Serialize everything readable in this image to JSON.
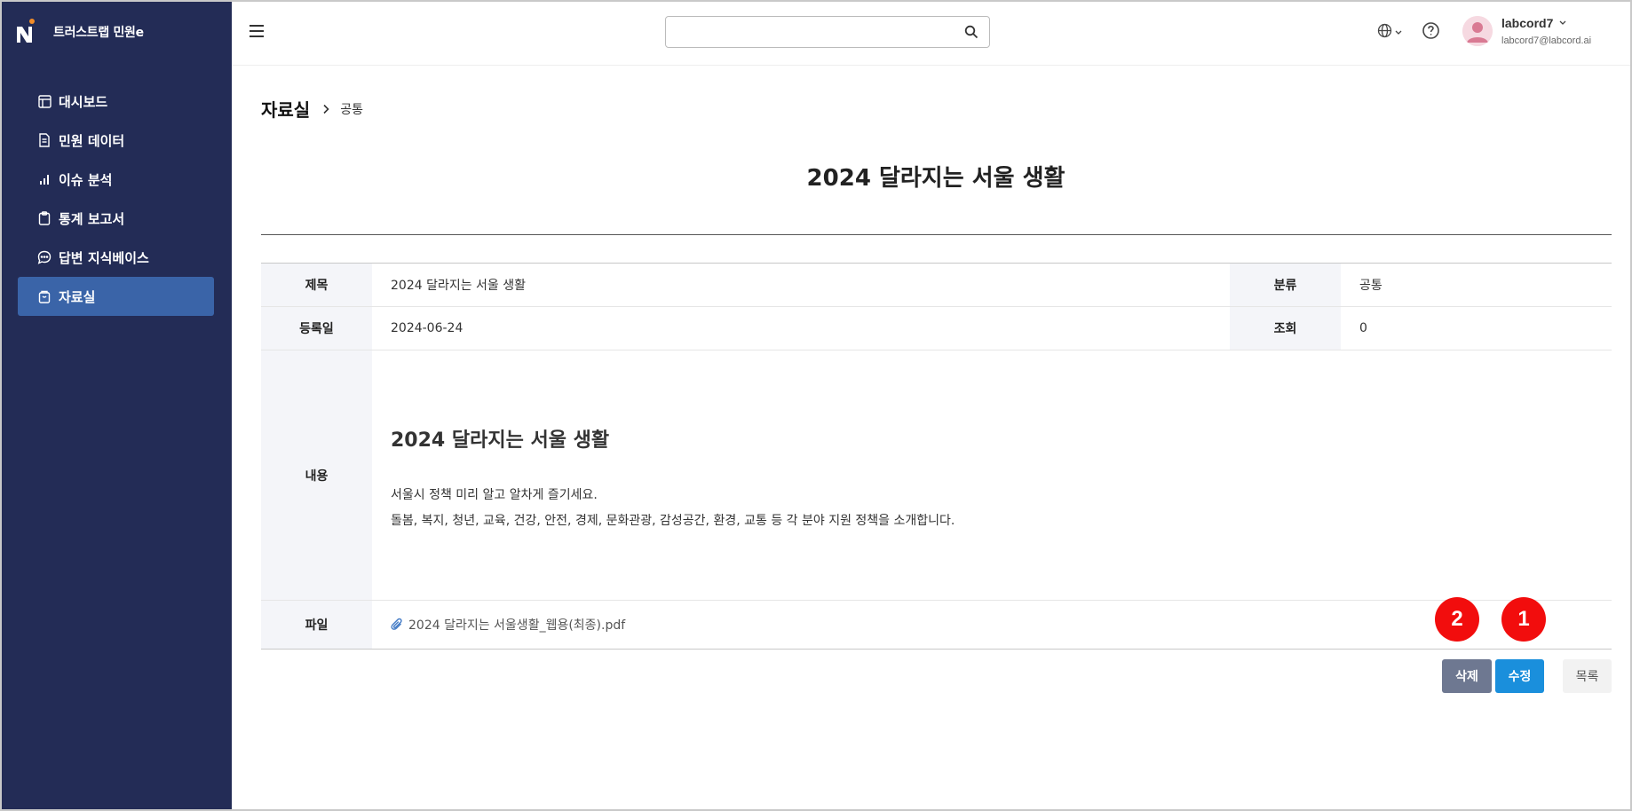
{
  "app": {
    "name": "트러스트랩 민원e"
  },
  "sidebar": {
    "items": [
      {
        "label": "대시보드",
        "icon": "dashboard-icon",
        "active": false
      },
      {
        "label": "민원 데이터",
        "icon": "document-icon",
        "active": false
      },
      {
        "label": "이슈 분석",
        "icon": "bar-chart-icon",
        "active": false
      },
      {
        "label": "통계 보고서",
        "icon": "clipboard-icon",
        "active": false
      },
      {
        "label": "답변 지식베이스",
        "icon": "chat-bubble-icon",
        "active": false
      },
      {
        "label": "자료실",
        "icon": "archive-box-icon",
        "active": true
      }
    ]
  },
  "header": {
    "search_placeholder": "",
    "user_name": "labcord7",
    "user_email": "labcord7@labcord.ai"
  },
  "breadcrumb": {
    "main": "자료실",
    "sub": "공통"
  },
  "page": {
    "title": "2024 달라지는 서울 생활"
  },
  "detail": {
    "title_label": "제목",
    "title_value": "2024 달라지는 서울 생활",
    "category_label": "분류",
    "category_value": "공통",
    "date_label": "등록일",
    "date_value": "2024-06-24",
    "views_label": "조회",
    "views_value": "0",
    "content_label": "내용",
    "content_title": "2024 달라지는 서울 생활",
    "content_lines": [
      "서울시 정책 미리 알고 알차게 즐기세요.",
      "돌봄, 복지, 청년, 교육, 건강, 안전, 경제, 문화관광, 감성공간, 환경, 교통 등 각 분야 지원 정책을 소개합니다."
    ],
    "file_label": "파일",
    "file_name": "2024 달라지는 서울생활_웹용(최종).pdf"
  },
  "actions": {
    "delete_label": "삭제",
    "edit_label": "수정",
    "list_label": "목록"
  },
  "annotations": {
    "badge_1": "1",
    "badge_2": "2"
  },
  "colors": {
    "sidebar_bg": "#232c56",
    "sidebar_active": "#3a64a8",
    "edit_button": "#1a8fdc",
    "delete_button": "#6e7891",
    "badge": "#f20d0d"
  }
}
